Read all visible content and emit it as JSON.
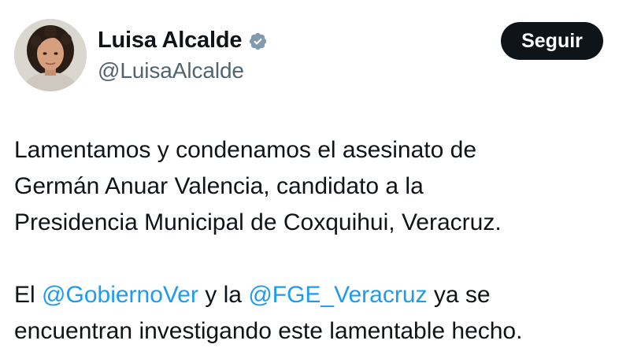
{
  "author": {
    "display_name": "Luisa Alcalde",
    "handle": "@LuisaAlcalde",
    "verified": true,
    "verified_badge_icon": "verified-badge-icon",
    "verified_badge_color": "#829aab"
  },
  "follow_button": {
    "label": "Seguir",
    "background": "#0f1419",
    "text_color": "#ffffff"
  },
  "tweet": {
    "paragraph1": {
      "line1": "Lamentamos y condenamos el asesinato de",
      "line2": "Germán Anuar Valencia, candidato a la",
      "line3": "Presidencia Municipal de Coxquihui, Veracruz."
    },
    "paragraph2": {
      "text_el": "El",
      "mention1": "@GobiernoVer",
      "text_y_la": "y la",
      "mention2": "@FGE_Veracruz",
      "text_ya_se": "ya se",
      "line2": "encuentran investigando este lamentable hecho."
    },
    "mention_color": "#1d9bf0"
  }
}
